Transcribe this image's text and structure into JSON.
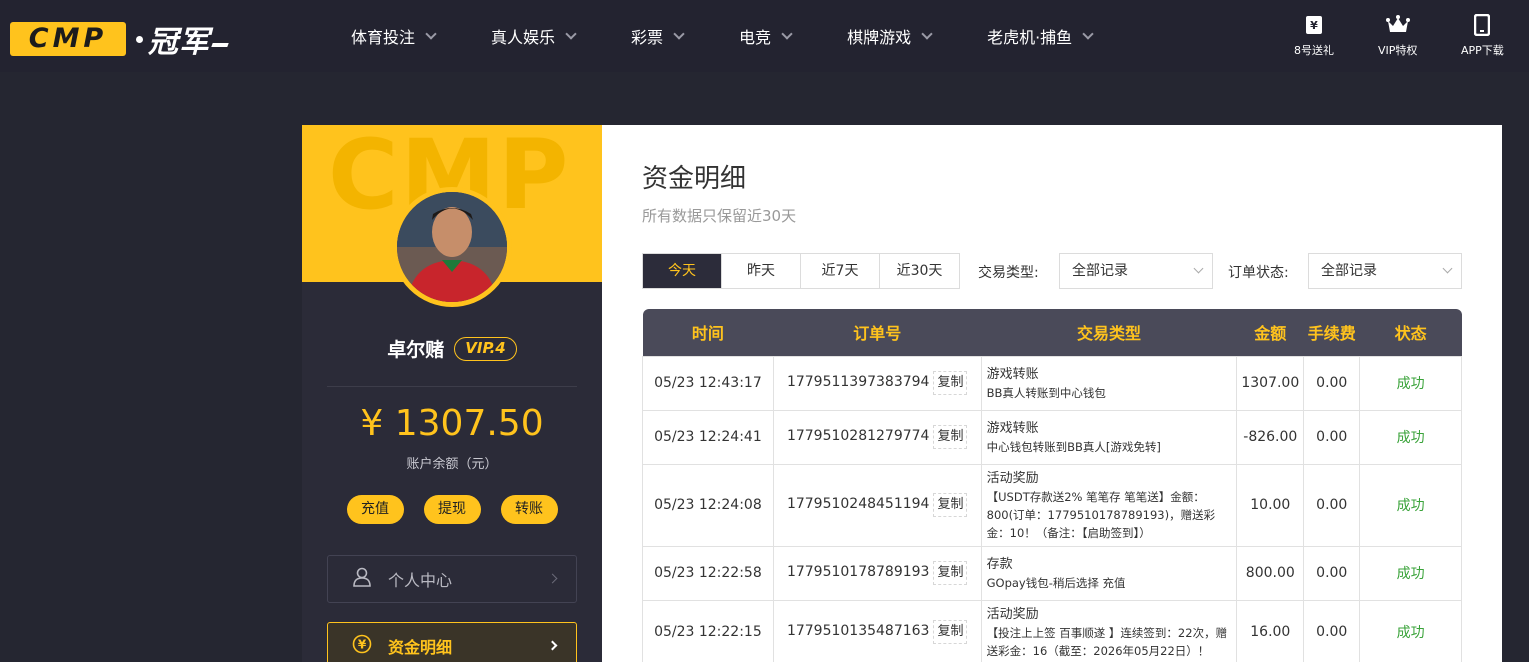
{
  "header": {
    "logo_text": "CMP",
    "logo_cn": "冠军",
    "nav": [
      {
        "label": "体育投注"
      },
      {
        "label": "真人娱乐"
      },
      {
        "label": "彩票"
      },
      {
        "label": "电竞"
      },
      {
        "label": "棋牌游戏"
      },
      {
        "label": "老虎机·捕鱼"
      }
    ],
    "quick": [
      {
        "label": "8号送礼",
        "icon": "gift-ticket-icon"
      },
      {
        "label": "VIP特权",
        "icon": "crown-icon"
      },
      {
        "label": "APP下载",
        "icon": "phone-icon"
      }
    ]
  },
  "sidebar": {
    "watermark": "CMP",
    "username": "卓尔赌",
    "vip": "VIP.4",
    "balance": "¥ 1307.50",
    "balance_label": "账户余额（元）",
    "actions": {
      "deposit": "充值",
      "withdraw": "提现",
      "transfer": "转账"
    },
    "menu": [
      {
        "label": "个人中心",
        "icon": "user-icon"
      },
      {
        "label": "资金明细",
        "icon": "yen-coin-icon",
        "active": true
      }
    ]
  },
  "main": {
    "title": "资金明细",
    "subtitle": "所有数据只保留近30天",
    "ranges": [
      "今天",
      "昨天",
      "近7天",
      "近30天"
    ],
    "active_range": "今天",
    "filters": {
      "type_label": "交易类型:",
      "type_value": "全部记录",
      "status_label": "订单状态:",
      "status_value": "全部记录"
    },
    "table": {
      "headers": [
        "时间",
        "订单号",
        "交易类型",
        "金额",
        "手续费",
        "状态"
      ],
      "copy_label": "复制",
      "rows": [
        {
          "time": "05/23 12:43:17",
          "order": "1779511397383794",
          "type": "游戏转账",
          "detail": "BB真人转账到中心钱包",
          "amount": "1307.00",
          "fee": "0.00",
          "status": "成功"
        },
        {
          "time": "05/23 12:24:41",
          "order": "1779510281279774",
          "type": "游戏转账",
          "detail": "中心钱包转账到BB真人[游戏免转]",
          "amount": "-826.00",
          "fee": "0.00",
          "status": "成功"
        },
        {
          "time": "05/23 12:24:08",
          "order": "1779510248451194",
          "type": "活动奖励",
          "detail": "【USDT存款送2% 笔笔存 笔笔送】金额：800(订单：1779510178789193)，赠送彩金：10！（备注：【启助签到】）",
          "amount": "10.00",
          "fee": "0.00",
          "status": "成功"
        },
        {
          "time": "05/23 12:22:58",
          "order": "1779510178789193",
          "type": "存款",
          "detail": "GOpay钱包-稍后选择 充值",
          "amount": "800.00",
          "fee": "0.00",
          "status": "成功"
        },
        {
          "time": "05/23 12:22:15",
          "order": "1779510135487163",
          "type": "活动奖励",
          "detail": "【投注上上签 百事顺遂 】连续签到：22次，赠送彩金：16（截至：2026年05月22日）！",
          "amount": "16.00",
          "fee": "0.00",
          "status": "成功"
        }
      ]
    }
  }
}
